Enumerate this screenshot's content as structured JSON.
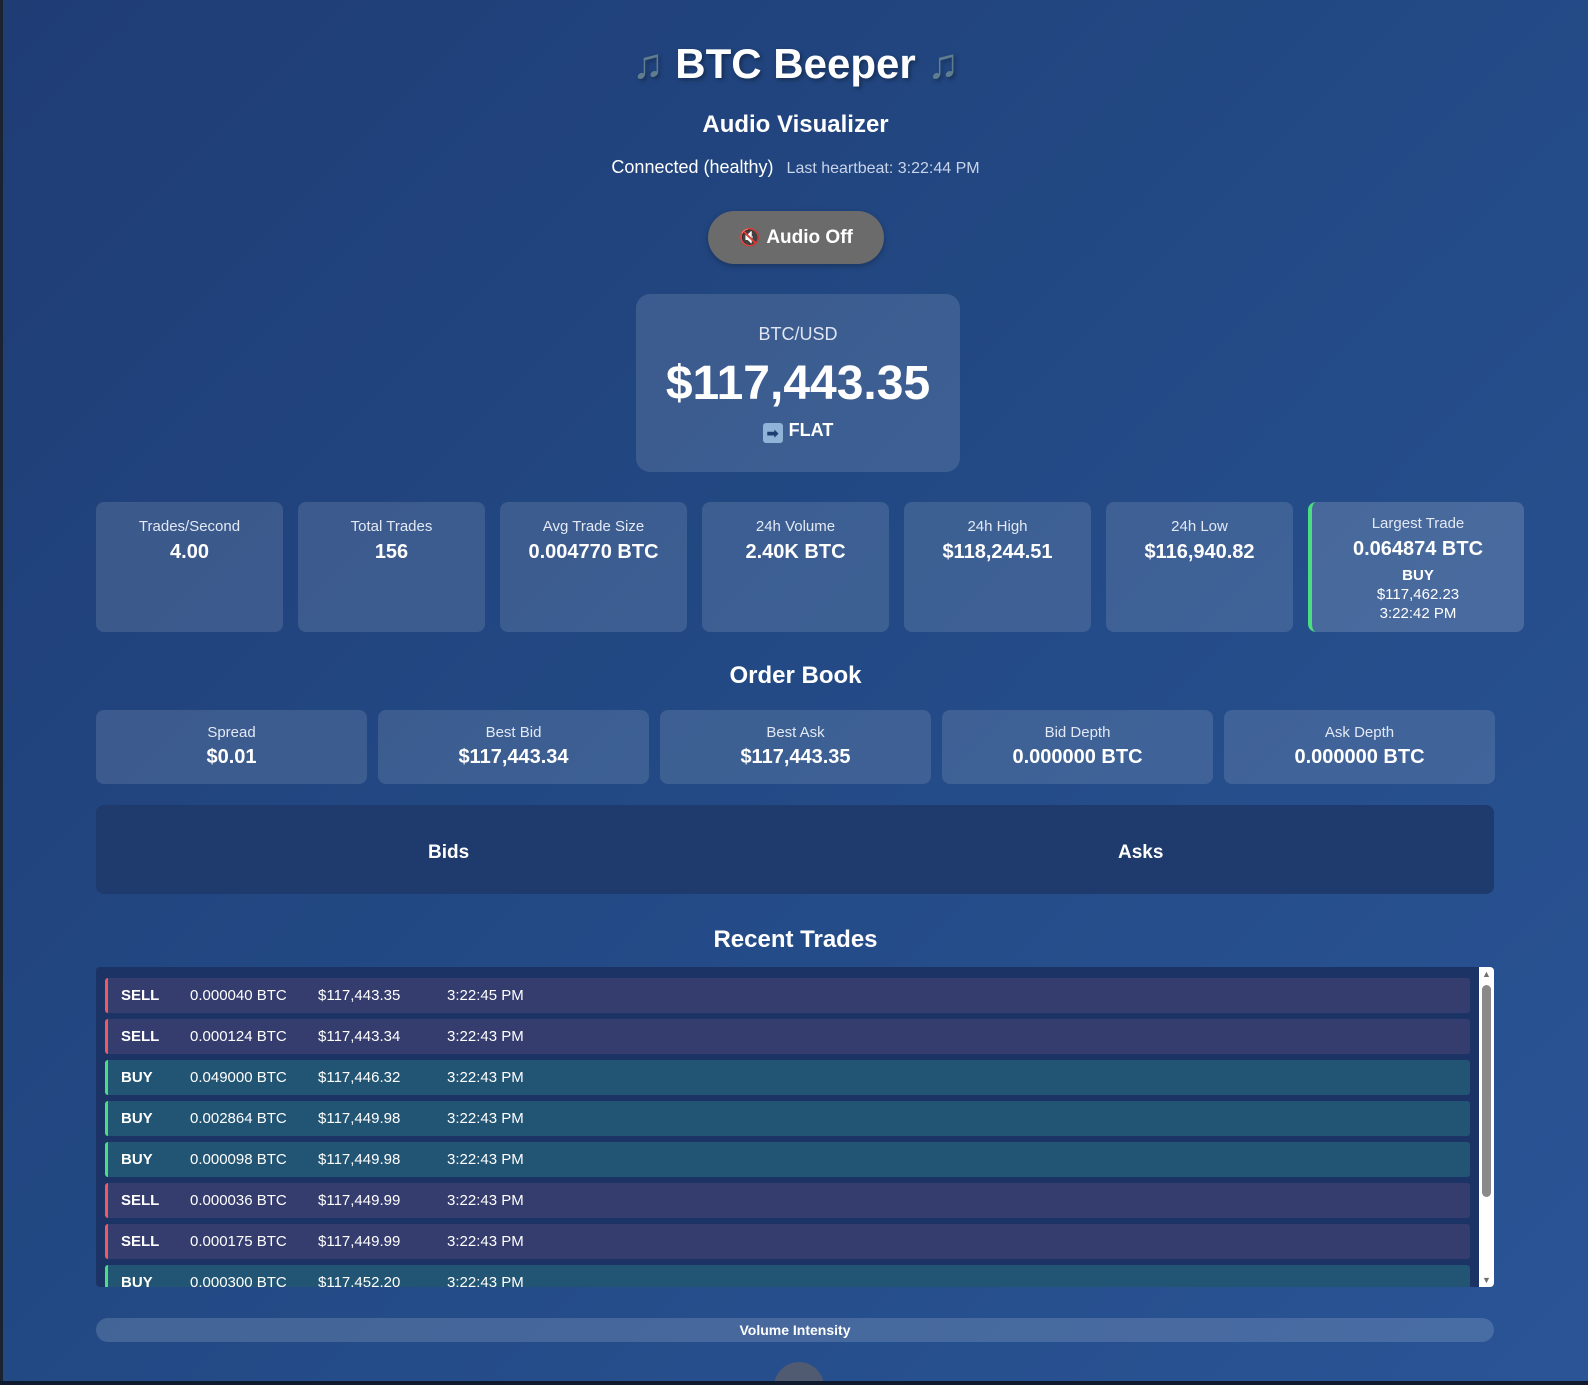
{
  "header": {
    "note_icon": "music-note",
    "title": "BTC Beeper",
    "subtitle": "Audio Visualizer",
    "status": "Connected (healthy)",
    "heartbeat": "Last heartbeat: 3:22:44 PM"
  },
  "audio_button": {
    "icon": "muted-speaker",
    "label": "Audio Off"
  },
  "price": {
    "pair": "BTC/USD",
    "value": "$117,443.35",
    "trend_icon": "right-arrow",
    "trend": "FLAT"
  },
  "stats": [
    {
      "label": "Trades/Second",
      "value": "4.00"
    },
    {
      "label": "Total Trades",
      "value": "156"
    },
    {
      "label": "Avg Trade Size",
      "value": "0.004770 BTC"
    },
    {
      "label": "24h Volume",
      "value": "2.40K BTC"
    },
    {
      "label": "24h High",
      "value": "$118,244.51"
    },
    {
      "label": "24h Low",
      "value": "$116,940.82"
    }
  ],
  "largest_trade": {
    "label": "Largest Trade",
    "value": "0.064874 BTC",
    "side": "BUY",
    "price": "$117,462.23",
    "time": "3:22:42 PM"
  },
  "order_book": {
    "title": "Order Book",
    "metrics": [
      {
        "label": "Spread",
        "value": "$0.01"
      },
      {
        "label": "Best Bid",
        "value": "$117,443.34"
      },
      {
        "label": "Best Ask",
        "value": "$117,443.35"
      },
      {
        "label": "Bid Depth",
        "value": "0.000000 BTC"
      },
      {
        "label": "Ask Depth",
        "value": "0.000000 BTC"
      }
    ],
    "bids_label": "Bids",
    "asks_label": "Asks"
  },
  "recent_trades": {
    "title": "Recent Trades",
    "rows": [
      {
        "side": "SELL",
        "amount": "0.000040 BTC",
        "price": "$117,443.35",
        "time": "3:22:45 PM"
      },
      {
        "side": "SELL",
        "amount": "0.000124 BTC",
        "price": "$117,443.34",
        "time": "3:22:43 PM"
      },
      {
        "side": "BUY",
        "amount": "0.049000 BTC",
        "price": "$117,446.32",
        "time": "3:22:43 PM"
      },
      {
        "side": "BUY",
        "amount": "0.002864 BTC",
        "price": "$117,449.98",
        "time": "3:22:43 PM"
      },
      {
        "side": "BUY",
        "amount": "0.000098 BTC",
        "price": "$117,449.98",
        "time": "3:22:43 PM"
      },
      {
        "side": "SELL",
        "amount": "0.000036 BTC",
        "price": "$117,449.99",
        "time": "3:22:43 PM"
      },
      {
        "side": "SELL",
        "amount": "0.000175 BTC",
        "price": "$117,449.99",
        "time": "3:22:43 PM"
      },
      {
        "side": "BUY",
        "amount": "0.000300 BTC",
        "price": "$117,452.20",
        "time": "3:22:43 PM"
      }
    ]
  },
  "volume_intensity": {
    "label": "Volume Intensity"
  },
  "colors": {
    "sell_accent": "#ef5a62",
    "buy_accent": "#4ade80",
    "sell_row": "#353c6e",
    "buy_row": "#225574",
    "background": "#234a85"
  }
}
